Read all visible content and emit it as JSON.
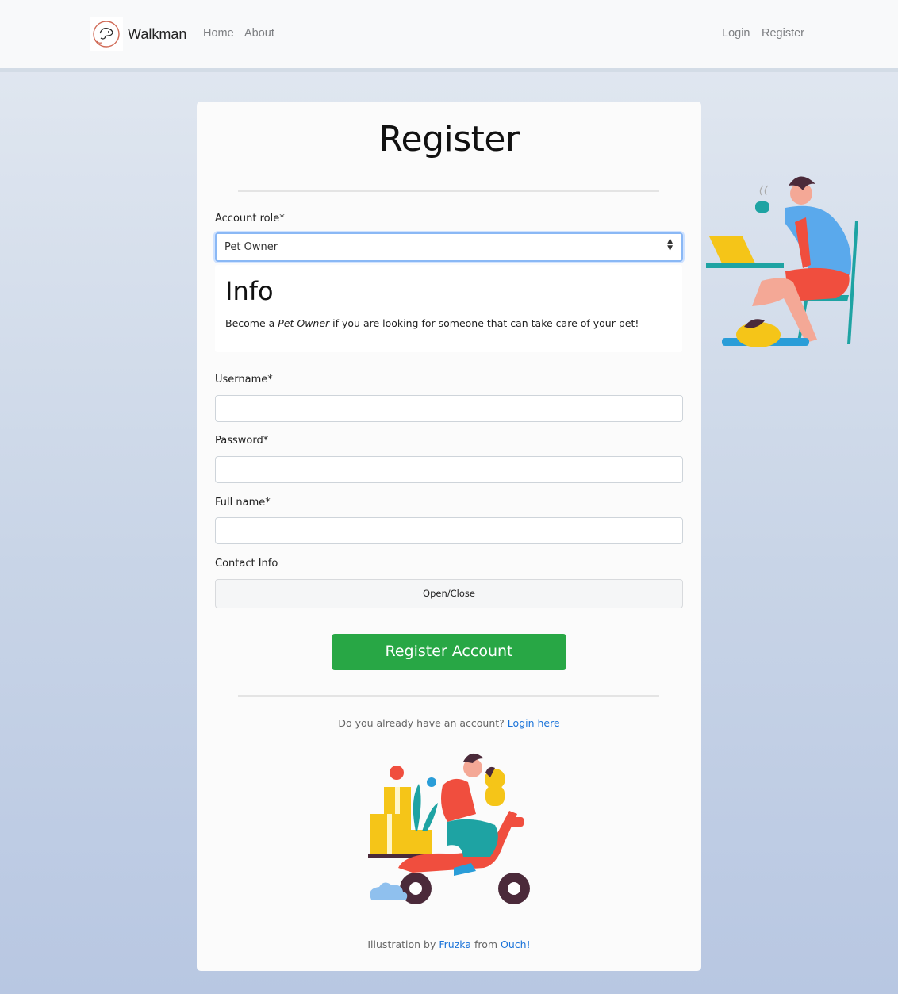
{
  "nav": {
    "brand": "Walkman",
    "links_left": [
      "Home",
      "About"
    ],
    "links_right": [
      "Login",
      "Register"
    ]
  },
  "form": {
    "title": "Register",
    "role_label": "Account role*",
    "role_value": "Pet Owner",
    "info": {
      "title": "Info",
      "text_before": "Become a ",
      "text_emphasis": "Pet Owner",
      "text_after": " if you are looking for someone that can take care of your pet!"
    },
    "username_label": "Username*",
    "username_value": "",
    "password_label": "Password*",
    "password_value": "",
    "fullname_label": "Full name*",
    "fullname_value": "",
    "contact_label": "Contact Info",
    "contact_toggle": "Open/Close",
    "submit_label": "Register Account"
  },
  "footer": {
    "login_prompt": "Do you already have an account?",
    "login_link": "Login here",
    "credit_prefix": "Illustration by",
    "credit_author": "Fruzka",
    "credit_from": "from",
    "credit_source": "Ouch!"
  },
  "colors": {
    "primary_button": "#28a745",
    "link": "#1a73d9",
    "select_focus": "#8ab8f5"
  }
}
